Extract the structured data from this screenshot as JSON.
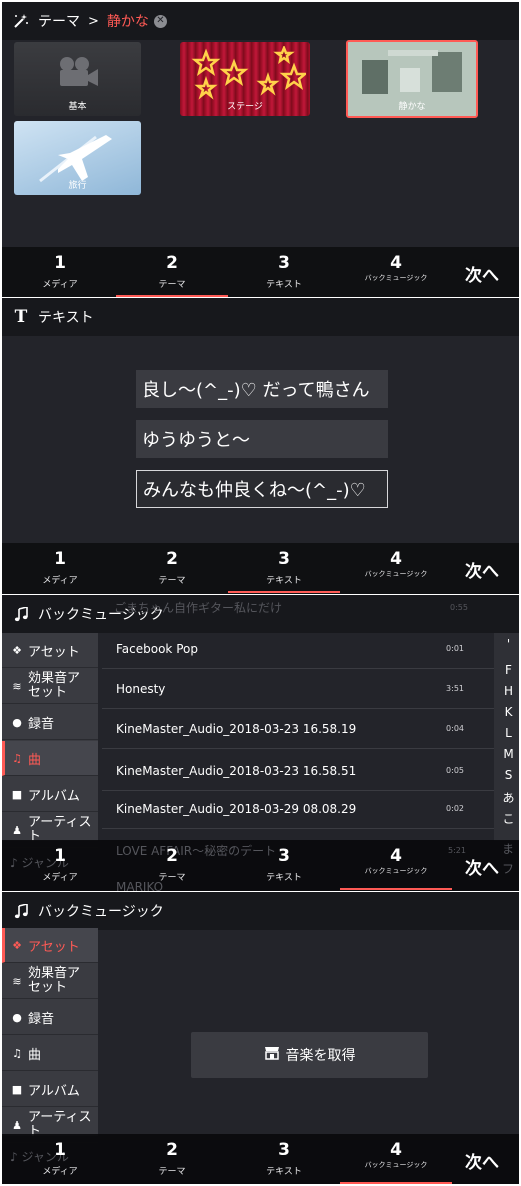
{
  "nav": {
    "items": [
      {
        "num": "1",
        "label": "メディア"
      },
      {
        "num": "2",
        "label": "テーマ"
      },
      {
        "num": "3",
        "label": "テキスト"
      },
      {
        "num": "4",
        "label": "バックミュージック"
      }
    ],
    "next": "次へ",
    "accent_color": "#ff5a55"
  },
  "panel1": {
    "header_label": "テーマ",
    "breadcrumb_current": "静かな",
    "themes": [
      {
        "name": "基本",
        "icon": "movie-camera-icon"
      },
      {
        "name": "ステージ",
        "icon": "stars-icon"
      },
      {
        "name": "静かな",
        "icon": "window-icon",
        "selected": true
      },
      {
        "name": "旅行",
        "icon": "airplane-icon"
      }
    ]
  },
  "panel2": {
    "header_label": "テキスト",
    "fields": [
      "良し〜(^_-)♡ だって鴨さん",
      "ゆうゆうと〜",
      "みんなも仲良くね〜(^_-)♡"
    ]
  },
  "panel3": {
    "header_label": "バックミュージック",
    "ghost_top": "ごまちゃん自作ギター私にだけ",
    "ghost_top_dur": "0:55",
    "categories": [
      "アセット",
      "効果音アセット",
      "録音",
      "曲",
      "アルバム",
      "アーティスト",
      "ジャンル"
    ],
    "tracks": [
      {
        "title": "Facebook Pop",
        "dur": "0:01"
      },
      {
        "title": "Honesty",
        "dur": "3:51"
      },
      {
        "title": "KineMaster_Audio_2018-03-23 16.58.19",
        "dur": "0:04"
      },
      {
        "title": "KineMaster_Audio_2018-03-23 16.58.51",
        "dur": "0:05"
      },
      {
        "title": "KineMaster_Audio_2018-03-29 08.08.29",
        "dur": "0:02"
      }
    ],
    "ghost_bottom": "LOVE AFFAIR〜秘密のデート",
    "ghost_bottom_dur": "5:21",
    "ghost_bottom2": "MARIKO",
    "index": [
      "'",
      "F",
      "H",
      "K",
      "L",
      "M",
      "S",
      "あ",
      "こ",
      "ま",
      "フ"
    ]
  },
  "panel4": {
    "header_label": "バックミュージック",
    "get_music": "音楽を取得"
  }
}
